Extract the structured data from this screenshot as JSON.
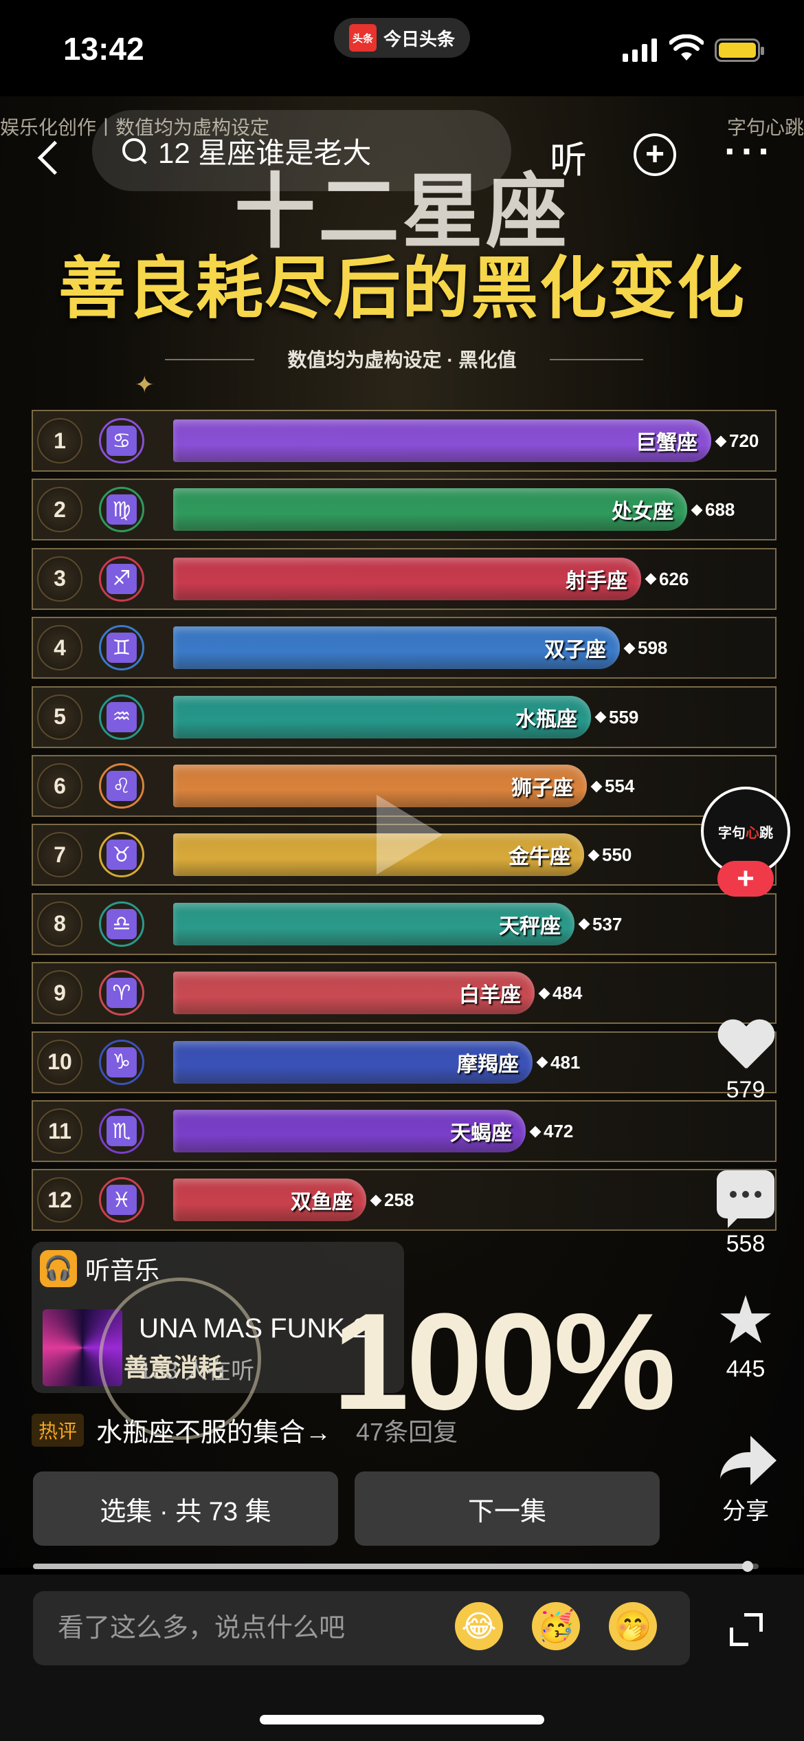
{
  "status_bar": {
    "time": "13:42",
    "app_logo": "头条",
    "app_name": "今日头条"
  },
  "header": {
    "credit_left": "娱乐化创作丨数值均为虚构设定",
    "credit_right": "字句心跳",
    "search_text": "12 星座谁是老大",
    "listen_label": "听",
    "plus_icon": "plus-circle-icon",
    "more_label": "···"
  },
  "video": {
    "title_line1": "十二星座",
    "title_line2": "善良耗尽后的黑化变化",
    "subtitle": "数值均为虚构设定 · 黑化值",
    "play_icon": "play-icon",
    "overlay_ring_text": "善意消耗",
    "overlay_big_text": "100%"
  },
  "chart_data": {
    "type": "bar",
    "orientation": "horizontal",
    "title": "十二星座",
    "subtitle": "数值均为虚构设定 · 黑化值",
    "categories": [
      "巨蟹座",
      "处女座",
      "射手座",
      "双子座",
      "水瓶座",
      "狮子座",
      "金牛座",
      "天秤座",
      "白羊座",
      "摩羯座",
      "天蝎座",
      "双鱼座"
    ],
    "ranks": [
      "1",
      "2",
      "3",
      "4",
      "5",
      "6",
      "7",
      "8",
      "9",
      "10",
      "11",
      "12"
    ],
    "values": [
      720,
      688,
      626,
      598,
      559,
      554,
      550,
      537,
      484,
      481,
      472,
      258
    ],
    "value_labels": [
      "720",
      "688",
      "626",
      "598",
      "559",
      "554",
      "550",
      "537",
      "484",
      "481",
      "472",
      "258"
    ],
    "symbols": [
      "♋",
      "♍",
      "♐",
      "♊",
      "♒",
      "♌",
      "♉",
      "♎",
      "♈",
      "♑",
      "♏",
      "♓"
    ],
    "colors": [
      "#8a4fd6",
      "#2f9a5c",
      "#c93a4e",
      "#3a7ac9",
      "#25978a",
      "#d9823c",
      "#d8a93a",
      "#2a9a8a",
      "#c94a52",
      "#3a52b8",
      "#7a3ec9",
      "#c9404c"
    ],
    "xlim": [
      0,
      800
    ],
    "grid": false
  },
  "rail": {
    "avatar_text_a": "字句",
    "avatar_text_b": "心",
    "avatar_text_c": "跳",
    "follow_label": "+",
    "like_count": "579",
    "comment_count": "558",
    "favorite_count": "445",
    "share_label": "分享"
  },
  "music": {
    "header": "听音乐",
    "song_title": "UNA MAS FUNK 2",
    "listeners": "138 人在听"
  },
  "hot_comment": {
    "tag": "热评",
    "text": "水瓶座不服的集合→",
    "replies": "47条回复"
  },
  "episodes": {
    "select_label": "选集 · 共 73 集",
    "next_label": "下一集"
  },
  "progress": {
    "value": 0.985
  },
  "comment_input": {
    "placeholder": "看了这么多，说点什么吧",
    "emojis": [
      "😂",
      "🥳",
      "🤭"
    ]
  }
}
